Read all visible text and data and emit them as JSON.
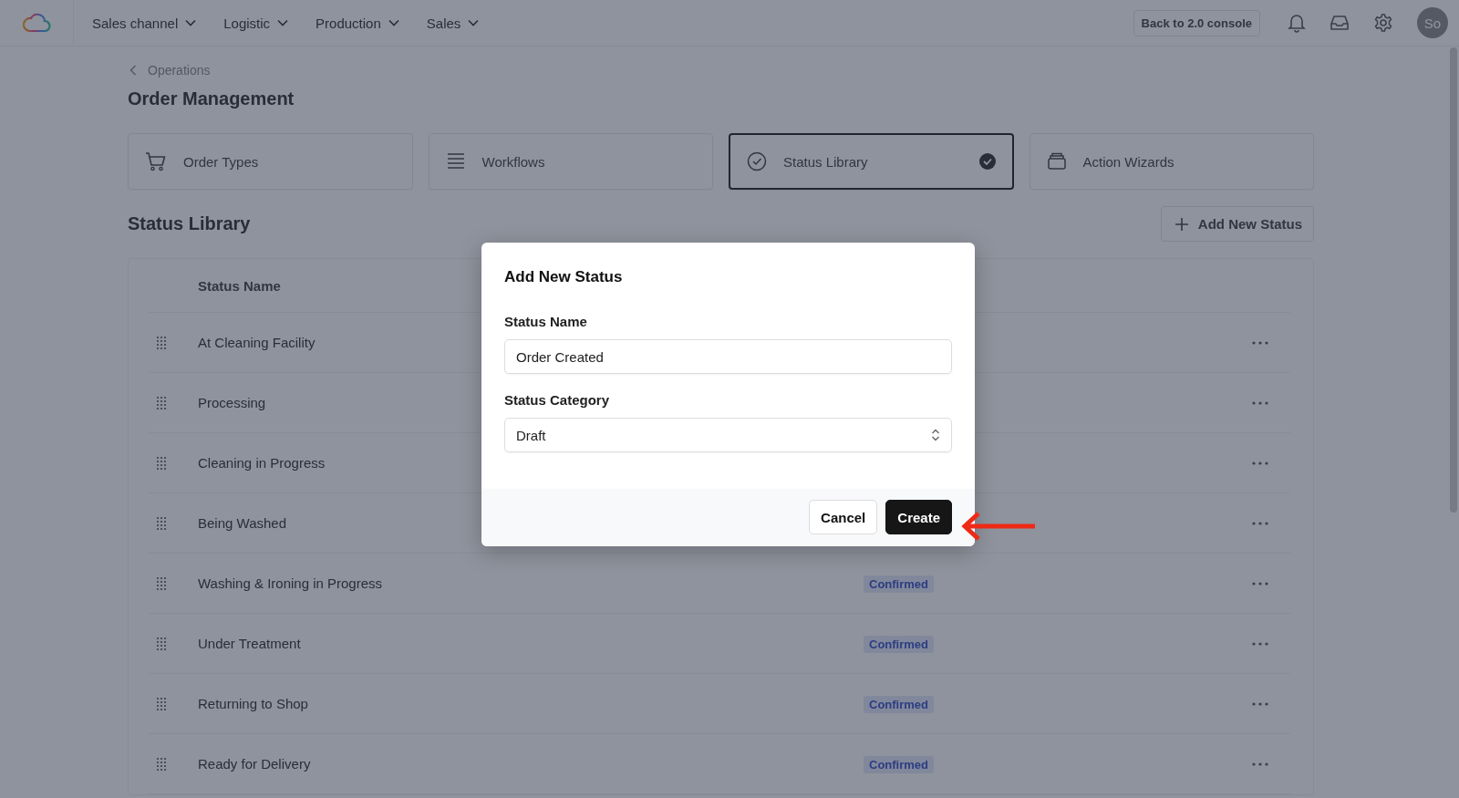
{
  "nav": {
    "menus": [
      {
        "label": "Sales channel"
      },
      {
        "label": "Logistic"
      },
      {
        "label": "Production"
      },
      {
        "label": "Sales"
      }
    ],
    "console_button": "Back to 2.0 console",
    "avatar": "So"
  },
  "breadcrumb": "Operations",
  "page_title": "Order Management",
  "tabs": [
    {
      "label": "Order Types",
      "selected": false
    },
    {
      "label": "Workflows",
      "selected": false
    },
    {
      "label": "Status Library",
      "selected": true
    },
    {
      "label": "Action Wizards",
      "selected": false
    }
  ],
  "section_title": "Status Library",
  "add_button": "Add New Status",
  "table": {
    "columns": [
      "Status Name"
    ],
    "rows": [
      {
        "name": "At Cleaning Facility"
      },
      {
        "name": "Processing"
      },
      {
        "name": "Cleaning in Progress"
      },
      {
        "name": "Being Washed"
      },
      {
        "name": "Washing & Ironing in Progress",
        "category": "Confirmed"
      },
      {
        "name": "Under Treatment",
        "category": "Confirmed"
      },
      {
        "name": "Returning to Shop",
        "category": "Confirmed"
      },
      {
        "name": "Ready for Delivery",
        "category": "Confirmed"
      }
    ]
  },
  "modal": {
    "title": "Add New Status",
    "fields": [
      {
        "kind": "text",
        "label": "Status Name",
        "value": "Order Created"
      },
      {
        "kind": "select",
        "label": "Status Category",
        "value": "Draft"
      }
    ],
    "buttons": [
      {
        "label": "Cancel",
        "kind": "secondary"
      },
      {
        "label": "Create",
        "kind": "primary"
      }
    ]
  }
}
